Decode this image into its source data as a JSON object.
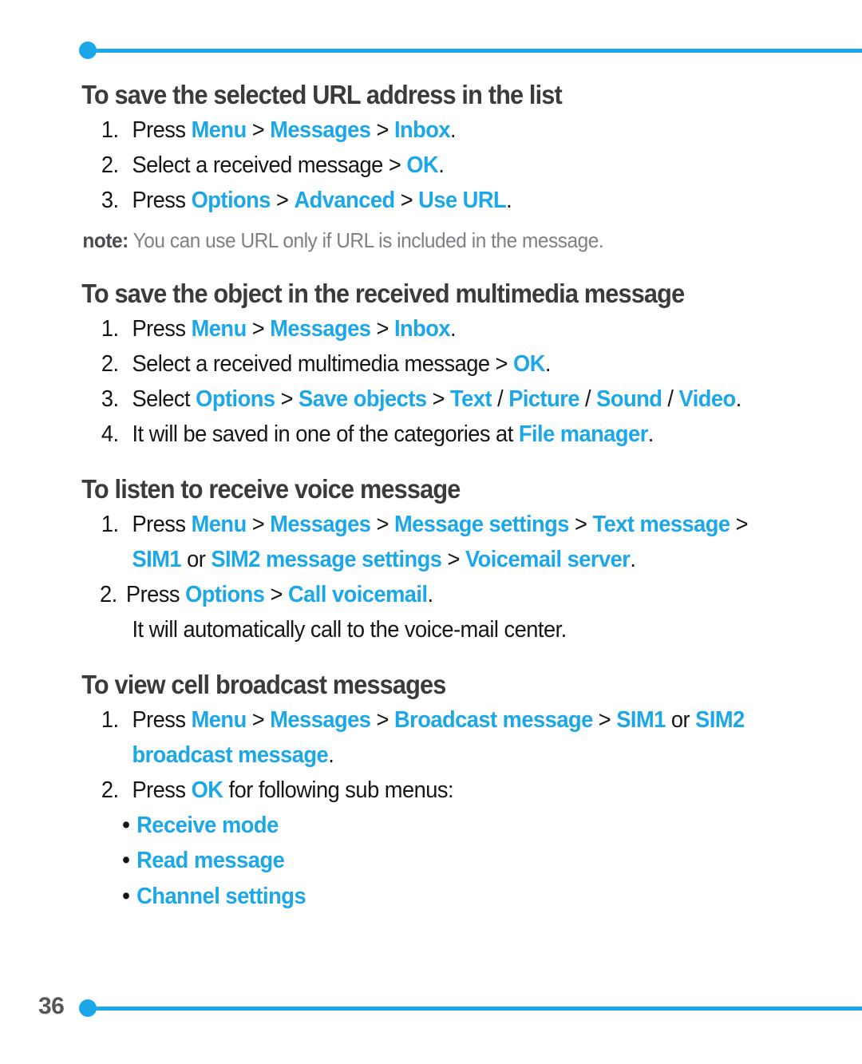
{
  "page": {
    "number": "36",
    "accent_color": "#1CA7E8",
    "heading_color": "#3b3b3d",
    "body_color": "#161616",
    "note_color": "#7e8084"
  },
  "sections": [
    {
      "heading": "To save the selected URL address in the list",
      "steps": [
        {
          "num": "1.",
          "runs": [
            {
              "t": "Press ",
              "s": "dark"
            },
            {
              "t": "Menu",
              "s": "menu"
            },
            {
              "t": " > ",
              "s": "sep"
            },
            {
              "t": "Messages",
              "s": "menu"
            },
            {
              "t": " > ",
              "s": "sep"
            },
            {
              "t": "Inbox",
              "s": "menu"
            },
            {
              "t": ".",
              "s": "dark"
            }
          ]
        },
        {
          "num": "2.",
          "runs": [
            {
              "t": "Select a received message > ",
              "s": "dark"
            },
            {
              "t": "OK",
              "s": "menu"
            },
            {
              "t": ".",
              "s": "dark"
            }
          ]
        },
        {
          "num": "3.",
          "runs": [
            {
              "t": "Press ",
              "s": "dark"
            },
            {
              "t": "Options",
              "s": "menu"
            },
            {
              "t": " > ",
              "s": "sep"
            },
            {
              "t": "Advanced",
              "s": "menu"
            },
            {
              "t": " > ",
              "s": "sep"
            },
            {
              "t": "Use URL",
              "s": "menu"
            },
            {
              "t": ".",
              "s": "dark"
            }
          ]
        }
      ],
      "note": {
        "label": "note:",
        "text": " You can use URL only if URL is included in the message."
      }
    },
    {
      "heading": "To save the object in the received multimedia message",
      "steps": [
        {
          "num": "1.",
          "runs": [
            {
              "t": "Press ",
              "s": "dark"
            },
            {
              "t": "Menu",
              "s": "menu"
            },
            {
              "t": " > ",
              "s": "sep"
            },
            {
              "t": "Messages",
              "s": "menu"
            },
            {
              "t": " > ",
              "s": "sep"
            },
            {
              "t": "Inbox",
              "s": "menu"
            },
            {
              "t": ".",
              "s": "dark"
            }
          ]
        },
        {
          "num": "2.",
          "runs": [
            {
              "t": "Select a received multimedia message > ",
              "s": "dark"
            },
            {
              "t": "OK",
              "s": "menu"
            },
            {
              "t": ".",
              "s": "dark"
            }
          ]
        },
        {
          "num": "3.",
          "runs": [
            {
              "t": "Select ",
              "s": "dark"
            },
            {
              "t": "Options",
              "s": "menu"
            },
            {
              "t": " > ",
              "s": "sep"
            },
            {
              "t": "Save objects",
              "s": "menu"
            },
            {
              "t": " > ",
              "s": "sep"
            },
            {
              "t": "Text",
              "s": "menu"
            },
            {
              "t": " / ",
              "s": "sep"
            },
            {
              "t": "Picture",
              "s": "menu"
            },
            {
              "t": " / ",
              "s": "sep"
            },
            {
              "t": "Sound",
              "s": "menu"
            },
            {
              "t": " / ",
              "s": "sep"
            },
            {
              "t": "Video",
              "s": "menu"
            },
            {
              "t": ".",
              "s": "dark"
            }
          ]
        },
        {
          "num": "4.",
          "runs": [
            {
              "t": "It will be saved in one of the categories at ",
              "s": "dark"
            },
            {
              "t": "File manager",
              "s": "menu"
            },
            {
              "t": ".",
              "s": "dark"
            }
          ]
        }
      ]
    },
    {
      "heading": "To listen to receive voice message",
      "steps": [
        {
          "num": "1.",
          "runs": [
            {
              "t": "Press ",
              "s": "dark"
            },
            {
              "t": "Menu",
              "s": "menu"
            },
            {
              "t": " > ",
              "s": "sep"
            },
            {
              "t": "Messages",
              "s": "menu"
            },
            {
              "t": " > ",
              "s": "sep"
            },
            {
              "t": "Message settings",
              "s": "menu"
            },
            {
              "t": " > ",
              "s": "sep"
            },
            {
              "t": "Text message",
              "s": "menu"
            },
            {
              "t": " > ",
              "s": "sep"
            },
            {
              "t": "SIM1",
              "s": "menu"
            },
            {
              "t": " or ",
              "s": "sep"
            },
            {
              "t": "SIM2 message settings",
              "s": "menu"
            },
            {
              "t": " > ",
              "s": "sep"
            },
            {
              "t": "Voicemail server",
              "s": "menu"
            },
            {
              "t": ".",
              "s": "dark"
            }
          ]
        },
        {
          "num": "2.",
          "tight": true,
          "runs": [
            {
              "t": "Press ",
              "s": "dark"
            },
            {
              "t": "Options",
              "s": "menu"
            },
            {
              "t": " > ",
              "s": "sep"
            },
            {
              "t": "Call voicemail",
              "s": "menu"
            },
            {
              "t": ".",
              "s": "dark"
            }
          ]
        }
      ],
      "trailing_line": "It will automatically call to the voice-mail center."
    },
    {
      "heading": "To view cell broadcast messages",
      "steps": [
        {
          "num": "1.",
          "runs": [
            {
              "t": "Press ",
              "s": "dark"
            },
            {
              "t": "Menu",
              "s": "menu"
            },
            {
              "t": " > ",
              "s": "sep"
            },
            {
              "t": "Messages",
              "s": "menu"
            },
            {
              "t": " > ",
              "s": "sep"
            },
            {
              "t": "Broadcast message",
              "s": "menu"
            },
            {
              "t": " > ",
              "s": "sep"
            },
            {
              "t": "SIM1",
              "s": "menu"
            },
            {
              "t": " or ",
              "s": "sep"
            },
            {
              "t": "SIM2 broadcast message",
              "s": "menu"
            },
            {
              "t": ".",
              "s": "dark"
            }
          ]
        },
        {
          "num": "2.",
          "runs": [
            {
              "t": "Press ",
              "s": "dark"
            },
            {
              "t": "OK",
              "s": "menu"
            },
            {
              "t": " for following sub menus:",
              "s": "dark"
            }
          ]
        }
      ],
      "bullets": [
        {
          "marker": "•",
          "label": "Receive mode"
        },
        {
          "marker": "•",
          "label": "Read message"
        },
        {
          "marker": "•",
          "label": "Channel settings"
        }
      ]
    }
  ]
}
